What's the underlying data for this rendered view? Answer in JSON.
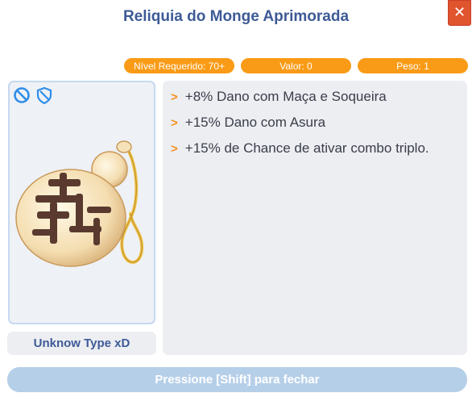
{
  "dialog": {
    "title": "Reliquia do Monge Aprimorada",
    "close_icon": "close-icon"
  },
  "stats": {
    "level": "Nível Requerido: 70+",
    "value": "Valor: 0",
    "weight": "Peso: 1"
  },
  "item": {
    "type_label": "Unknow Type xD",
    "badges": [
      "no-trade-icon",
      "shield-icon"
    ],
    "image_icon": "monk-relic-gourd-icon"
  },
  "description": {
    "lines": [
      "+8% Dano com Maça e Soqueira",
      "+15% Dano com Asura",
      "+15% de Chance de ativar combo triplo."
    ],
    "bullet": ">"
  },
  "footer": {
    "close_hint": "Pressione [Shift] para fechar"
  },
  "colors": {
    "title": "#3e5a96",
    "pill": "#f99b16",
    "close_button": "#e0542e",
    "footer_bar": "#b6cfe9",
    "bullet": "#f5901e"
  }
}
